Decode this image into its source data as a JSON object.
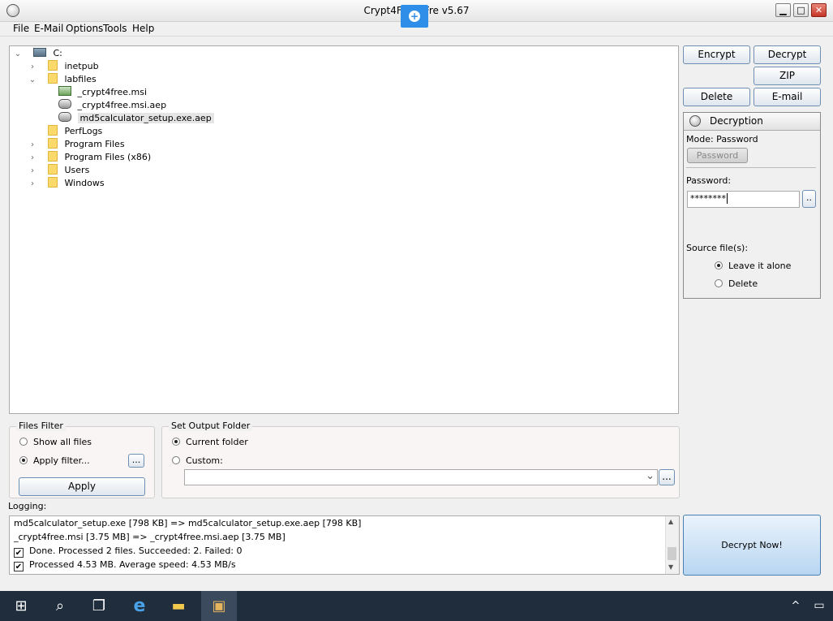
{
  "window": {
    "title": "Crypt4Free (Fre       v5.67",
    "min_glyph": "▁",
    "max_glyph": "□",
    "close_glyph": "✕"
  },
  "menu": [
    {
      "label": "File"
    },
    {
      "label": "E-Mail"
    },
    {
      "label": "Options"
    },
    {
      "label": "Tools"
    },
    {
      "label": "Help"
    }
  ],
  "tree": {
    "drive": "C:",
    "items": [
      {
        "label": "inetpub",
        "type": "folder",
        "expanded": false
      },
      {
        "label": "labfiles",
        "type": "folder",
        "expanded": true
      },
      {
        "label": "_crypt4free.msi",
        "type": "msi-file"
      },
      {
        "label": "_crypt4free.msi.aep",
        "type": "aep-file"
      },
      {
        "label": "md5calculator_setup.exe.aep",
        "type": "aep-file",
        "selected": true
      },
      {
        "label": "PerfLogs",
        "type": "folder"
      },
      {
        "label": "Program Files",
        "type": "folder"
      },
      {
        "label": "Program Files (x86)",
        "type": "folder"
      },
      {
        "label": "Users",
        "type": "folder"
      },
      {
        "label": "Windows",
        "type": "folder"
      }
    ]
  },
  "actions": {
    "encrypt": "Encrypt",
    "decrypt": "Decrypt",
    "zip": "ZIP",
    "delete": "Delete",
    "email": "E-mail"
  },
  "decryption": {
    "header": "Decryption",
    "mode_label": "Mode: Password",
    "password_button": "Password",
    "password_label": "Password:",
    "password_value": "********",
    "browse_label": "..",
    "source_label": "Source file(s):",
    "leave_alone": "Leave it alone",
    "delete": "Delete"
  },
  "files_filter": {
    "legend": "Files Filter",
    "show_all": "Show all files",
    "apply_filter": "Apply filter...",
    "browse": "...",
    "apply_button": "Apply"
  },
  "output_folder": {
    "legend": "Set Output Folder",
    "current": "Current folder",
    "custom": "Custom:",
    "browse": "...",
    "dropdown_glyph": "⌄"
  },
  "logging": {
    "label": "Logging:",
    "lines": [
      {
        "text": "md5calculator_setup.exe [798 KB] => md5calculator_setup.exe.aep [798 KB]",
        "check": false
      },
      {
        "text": "_crypt4free.msi [3.75 MB] => _crypt4free.msi.aep [3.75 MB]",
        "check": false
      },
      {
        "text": "Done. Processed 2 files. Succeeded: 2. Failed: 0",
        "check": true
      },
      {
        "text": "Processed 4.53 MB. Average speed: 4.53 MB/s",
        "check": true
      }
    ]
  },
  "decrypt_now": "Decrypt Now!",
  "icons": {
    "expand": "›",
    "collapse": "⌄",
    "scroll_up": "▲",
    "scroll_down": "▼",
    "check_mark": "✔"
  },
  "taskbar": {
    "start": "⊞",
    "search": "⌕",
    "taskview": "❐",
    "ie": "e",
    "explorer": "▬",
    "app": "▣",
    "tray_up": "^",
    "network": "▭"
  }
}
